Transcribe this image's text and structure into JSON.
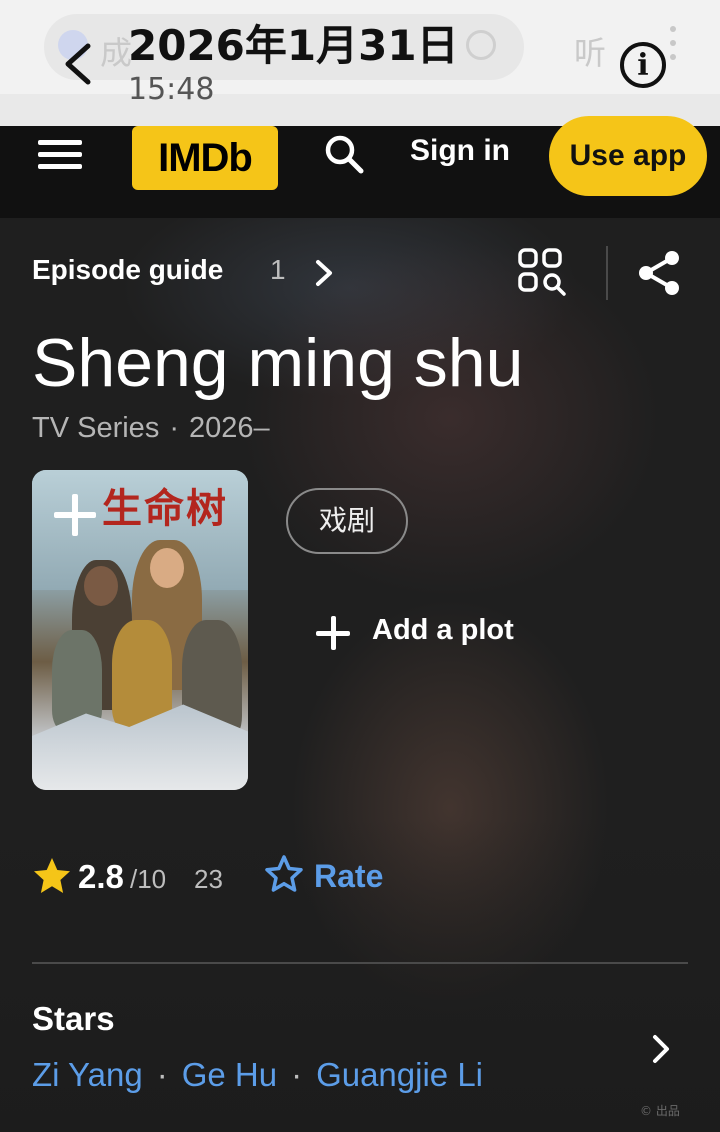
{
  "browser_bar": {
    "date": "2026年1月31日",
    "time": "15:48",
    "ghost_left_text": "成",
    "ghost_right_text": "听"
  },
  "header": {
    "logo": "IMDb",
    "sign_in": "Sign in",
    "use_app": "Use app",
    "accent_color": "#f5c518"
  },
  "hero": {
    "episode_guide_label": "Episode guide",
    "episode_count": "1",
    "title": "Sheng ming shu",
    "type": "TV Series",
    "meta_separator": "·",
    "years": "2026–",
    "poster_title": "生命树",
    "genre": "戏剧",
    "add_plot_label": "Add a plot"
  },
  "rating": {
    "value": "2.8",
    "max": "/10",
    "count": "23",
    "rate_label": "Rate",
    "star_color": "#f5c518",
    "link_color": "#5c9de8"
  },
  "stars": {
    "heading": "Stars",
    "separator": "·",
    "names": [
      "Zi Yang",
      "Ge Hu",
      "Guangjie Li"
    ]
  },
  "watermark": "© 出品"
}
